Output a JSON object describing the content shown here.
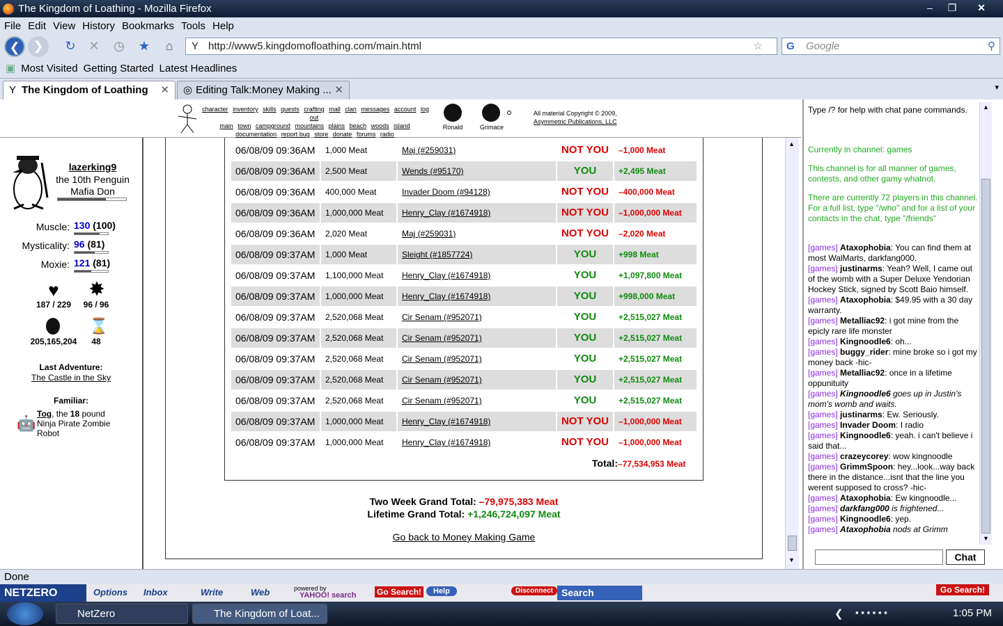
{
  "window": {
    "title": "The Kingdom of Loathing - Mozilla Firefox"
  },
  "menu": [
    "File",
    "Edit",
    "View",
    "History",
    "Bookmarks",
    "Tools",
    "Help"
  ],
  "nav": {
    "url": "http://www5.kingdomofloathing.com/main.html",
    "search_placeholder": "Google"
  },
  "bookmarks": [
    "Most Visited",
    "Getting Started",
    "Latest Headlines"
  ],
  "tabs": [
    {
      "label": "The Kingdom of Loathing"
    },
    {
      "label": "Editing Talk:Money Making ..."
    }
  ],
  "topmenu": {
    "links1": [
      "character",
      "inventory",
      "skills",
      "quests",
      "crafting",
      "mall",
      "clan",
      "messages",
      "account",
      "log out"
    ],
    "links2": [
      "main",
      "town",
      "campground",
      "mountains",
      "plains",
      "beach",
      "woods",
      "island"
    ],
    "links3": [
      "documentation",
      "report bug",
      "store",
      "donate",
      "forums",
      "radio"
    ],
    "moons": [
      "Ronald",
      "Grimace"
    ],
    "copyright": "All material Copyright © 2009,",
    "company": "Asymmetric Publications, LLC"
  },
  "character": {
    "name": "lazerking9",
    "title1": "the 10th Penguin",
    "title2": "Mafia Don",
    "stats": [
      {
        "label": "Muscle:",
        "value": "130",
        "base": "(100)"
      },
      {
        "label": "Mysticality:",
        "value": "96",
        "base": "(81)"
      },
      {
        "label": "Moxie:",
        "value": "121",
        "base": "(81)"
      }
    ],
    "hp": "187 / 229",
    "mp": "96 / 96",
    "meat": "205,165,204",
    "adventures": "48",
    "last_adv_label": "Last Adventure:",
    "last_adv": "The Castle in the Sky",
    "familiar_label": "Familiar:",
    "familiar_name": "Tog",
    "familiar_mid": ", the ",
    "familiar_weight": "18",
    "familiar_rest": " pound Ninja Pirate Zombie Robot"
  },
  "rows": [
    {
      "time": "06/08/09 09:36AM",
      "bet": "1,000 Meat",
      "player": "Maj (#259031)",
      "winner": "NOT YOU",
      "result": "–1,000 Meat",
      "win": false
    },
    {
      "time": "06/08/09 09:36AM",
      "bet": "2,500 Meat",
      "player": "Wends (#95170)",
      "winner": "YOU",
      "result": "+2,495 Meat",
      "win": true
    },
    {
      "time": "06/08/09 09:36AM",
      "bet": "400,000 Meat",
      "player": "Invader Doom (#94128)",
      "winner": "NOT YOU",
      "result": "–400,000 Meat",
      "win": false
    },
    {
      "time": "06/08/09 09:36AM",
      "bet": "1,000,000 Meat",
      "player": "Henry_Clay (#1674918)",
      "winner": "NOT YOU",
      "result": "–1,000,000 Meat",
      "win": false
    },
    {
      "time": "06/08/09 09:36AM",
      "bet": "2,020 Meat",
      "player": "Maj (#259031)",
      "winner": "NOT YOU",
      "result": "–2,020 Meat",
      "win": false
    },
    {
      "time": "06/08/09 09:37AM",
      "bet": "1,000 Meat",
      "player": "Sleight (#1857724)",
      "winner": "YOU",
      "result": "+998 Meat",
      "win": true
    },
    {
      "time": "06/08/09 09:37AM",
      "bet": "1,100,000 Meat",
      "player": "Henry_Clay (#1674918)",
      "winner": "YOU",
      "result": "+1,097,800 Meat",
      "win": true
    },
    {
      "time": "06/08/09 09:37AM",
      "bet": "1,000,000 Meat",
      "player": "Henry_Clay (#1674918)",
      "winner": "YOU",
      "result": "+998,000 Meat",
      "win": true
    },
    {
      "time": "06/08/09 09:37AM",
      "bet": "2,520,068 Meat",
      "player": "Cir Senam (#952071)",
      "winner": "YOU",
      "result": "+2,515,027 Meat",
      "win": true
    },
    {
      "time": "06/08/09 09:37AM",
      "bet": "2,520,068 Meat",
      "player": "Cir Senam (#952071)",
      "winner": "YOU",
      "result": "+2,515,027 Meat",
      "win": true
    },
    {
      "time": "06/08/09 09:37AM",
      "bet": "2,520,068 Meat",
      "player": "Cir Senam (#952071)",
      "winner": "YOU",
      "result": "+2,515,027 Meat",
      "win": true
    },
    {
      "time": "06/08/09 09:37AM",
      "bet": "2,520,068 Meat",
      "player": "Cir Senam (#952071)",
      "winner": "YOU",
      "result": "+2,515,027 Meat",
      "win": true
    },
    {
      "time": "06/08/09 09:37AM",
      "bet": "2,520,068 Meat",
      "player": "Cir Senam (#952071)",
      "winner": "YOU",
      "result": "+2,515,027 Meat",
      "win": true
    },
    {
      "time": "06/08/09 09:37AM",
      "bet": "1,000,000 Meat",
      "player": "Henry_Clay (#1674918)",
      "winner": "NOT YOU",
      "result": "–1,000,000 Meat",
      "win": false
    },
    {
      "time": "06/08/09 09:37AM",
      "bet": "1,000,000 Meat",
      "player": "Henry_Clay (#1674918)",
      "winner": "NOT YOU",
      "result": "–1,000,000 Meat",
      "win": false
    }
  ],
  "totals": {
    "total_label": "Total:",
    "total": "–77,534,953 Meat",
    "two_week_label": "Two Week Grand Total:",
    "two_week": "–79,975,383 Meat",
    "lifetime_label": "Lifetime Grand Total:",
    "lifetime": "+1,246,724,097 Meat",
    "back": "Go back to Money Making Game"
  },
  "chat": {
    "help": "Type /? for help with chat pane commands.",
    "channel": "Currently in channel: games",
    "desc": "This channel is for all manner of games, contests, and other gamy whatnot.",
    "count": "There are currently 72 players in this channel. For a full list, type \"/who\" and for a list of your contacts in the chat, type \"/friends\"",
    "tag": "[games]",
    "messages": [
      {
        "user": "Ataxophobia",
        "text": ": You can find them at most WalMarts, darkfang000.",
        "emote": false
      },
      {
        "user": "justinarms",
        "text": ": Yeah? Well, I came out of the womb with a Super Deluxe Yendorian Hockey Stick, signed by Scott Baio himself.",
        "emote": false
      },
      {
        "user": "Ataxophobia",
        "text": ": $49.95 with a 30 day warranty.",
        "emote": false
      },
      {
        "user": "Metalliac92",
        "text": ": i got mine from the epicly rare life monster",
        "emote": false
      },
      {
        "user": "Kingnoodle6",
        "text": ": oh...",
        "emote": false
      },
      {
        "user": "buggy_rider",
        "text": ": mine broke so i got my money back -hic-",
        "emote": false
      },
      {
        "user": "Metalliac92",
        "text": ": once in a lifetime oppunituity",
        "emote": false
      },
      {
        "user": "Kingnoodle6",
        "text": " goes up in Justin's mom's womb and waits.",
        "emote": true
      },
      {
        "user": "justinarms",
        "text": ": Ew. Seriously.",
        "emote": false
      },
      {
        "user": "Invader Doom",
        "text": ": I radio",
        "emote": false
      },
      {
        "user": "Kingnoodle6",
        "text": ": yeah. i can't believe i said that...",
        "emote": false
      },
      {
        "user": "crazeycorey",
        "text": ": wow kingnoodle",
        "emote": false
      },
      {
        "user": "GrimmSpoon",
        "text": ": hey...look...way back there in the distance...isnt that the line you werent supposed to cross? -hic-",
        "emote": false
      },
      {
        "user": "Ataxophobia",
        "text": ": Ew kingnoodle...",
        "emote": false
      },
      {
        "user": "darkfang000",
        "text": " is frightened...",
        "emote": true
      },
      {
        "user": "Kingnoodle6",
        "text": ": yep.",
        "emote": false
      },
      {
        "user": "Ataxophobia",
        "text": " nods at Grimm",
        "emote": true
      }
    ],
    "button": "Chat"
  },
  "status": "Done",
  "netzero": {
    "brand": "NETZERO",
    "options": "Options",
    "inbox": "Inbox",
    "write": "Write",
    "web": "Web",
    "powered": "powered by",
    "yahoo": "YAHOO! search",
    "go": "Go Search!",
    "help": "Help",
    "disconnect": "Disconnect",
    "search": "Search"
  },
  "taskbar": {
    "items": [
      "NetZero",
      "The Kingdom of Loat..."
    ],
    "clock": "1:05 PM"
  }
}
